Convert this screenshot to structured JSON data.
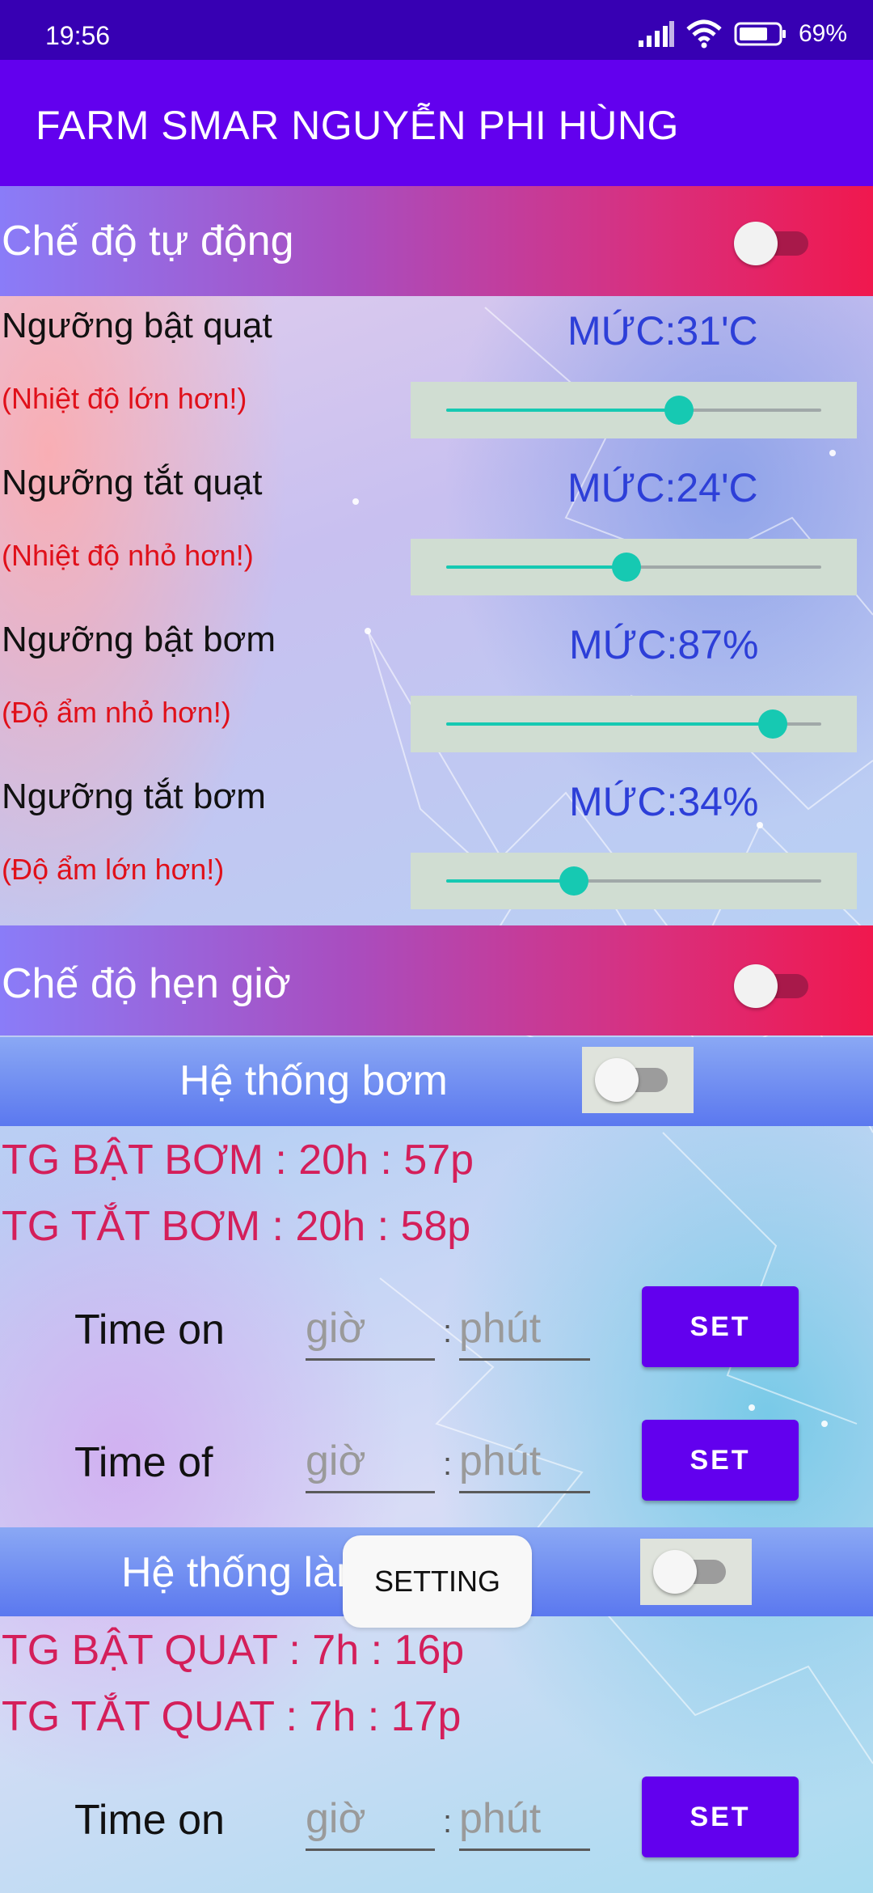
{
  "status_bar": {
    "time": "19:56",
    "battery": "69%"
  },
  "app_bar": {
    "title": "FARM SMAR NGUYỄN PHI HÙNG"
  },
  "auto_mode": {
    "label": "Chế độ tự động",
    "enabled": false,
    "thresholds": [
      {
        "label": "Ngưỡng bật quạt",
        "hint": "(Nhiệt độ lớn hơn!)",
        "level": "MỨC:31'C",
        "slider_fraction": 0.62
      },
      {
        "label": "Ngưỡng tắt quạt",
        "hint": "(Nhiệt độ nhỏ hơn!)",
        "level": "MỨC:24'C",
        "slider_fraction": 0.48
      },
      {
        "label": "Ngưỡng bật bơm",
        "hint": "(Độ ẩm nhỏ hơn!)",
        "level": "MỨC:87%",
        "slider_fraction": 0.87
      },
      {
        "label": "Ngưỡng tắt bơm",
        "hint": "(Độ ẩm lớn hơn!)",
        "level": "MỨC:34%",
        "slider_fraction": 0.34
      }
    ]
  },
  "timer_mode": {
    "label": "Chế độ hẹn giờ",
    "enabled": false
  },
  "pump_system": {
    "label": "Hệ thống bơm",
    "enabled": false,
    "on_time": "TG BẬT BƠM : 20h : 57p",
    "off_time": "TG TẮT BƠM : 20h : 58p",
    "rows": [
      {
        "label": "Time on",
        "hour_placeholder": "giờ",
        "minute_placeholder": "phút",
        "colon": ":",
        "button": "SET"
      },
      {
        "label": "Time of",
        "hour_placeholder": "giờ",
        "minute_placeholder": "phút",
        "colon": ":",
        "button": "SET"
      }
    ]
  },
  "fan_system": {
    "label": "Hệ thống làm",
    "enabled": false,
    "on_time": "TG BẬT QUAT : 7h : 16p",
    "off_time": "TG TẮT QUAT : 7h : 17p",
    "rows": [
      {
        "label": "Time on",
        "hour_placeholder": "giờ",
        "minute_placeholder": "phút",
        "colon": ":",
        "button": "SET"
      }
    ]
  },
  "toast": {
    "text": "SETTING"
  },
  "colors": {
    "status_bar": "#3700b3",
    "app_bar": "#6200ee",
    "accent": "#16c9b2",
    "level_text": "#2d3fd8",
    "hint_text": "#e0101a",
    "time_text": "#d41f5a"
  },
  "icons": [
    "signal-icon",
    "wifi-icon",
    "battery-icon"
  ]
}
